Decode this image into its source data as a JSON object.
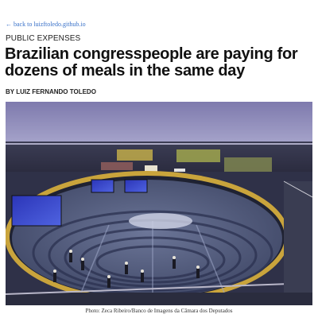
{
  "nav": {
    "back_label": "back to luizftoledo.github.io"
  },
  "article": {
    "section": "PUBLIC EXPENSES",
    "headline": "Brazilian congresspeople are paying for dozens of meals in the same day",
    "byline": "BY LUIZ FERNANDO TOLEDO"
  },
  "photo": {
    "caption": "Photo: Zeca Ribeiro/Banco de Imagens da Câmara dos Deputados",
    "subject": "chamber-of-deputies-plenary"
  },
  "colors": {
    "link": "#3a72c9",
    "ceiling": "#8a87b8",
    "gold_rim": "#c9a43c",
    "floor_seats": "#5a6488",
    "screen": "#3646c8"
  },
  "icons": {
    "back": "left-arrow-icon"
  }
}
